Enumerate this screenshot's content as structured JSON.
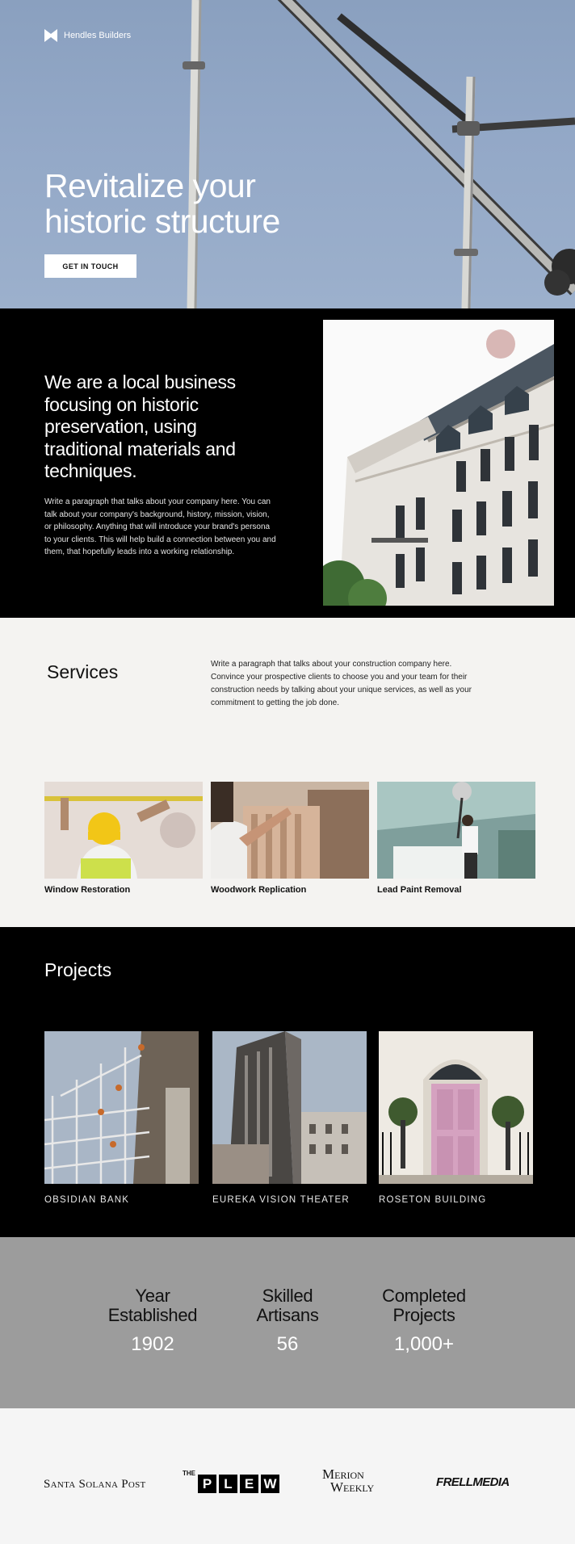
{
  "brand": {
    "name": "Hendles Builders"
  },
  "hero": {
    "title_line1": "Revitalize your",
    "title_line2": "historic structure",
    "cta_label": "GET IN TOUCH"
  },
  "about": {
    "heading": "We are a local business focusing on historic preservation, using traditional materials and techniques.",
    "body": "Write a paragraph that talks about your company here. You can talk about your company's background, history, mission, vision, or philosophy. Anything that will introduce your brand's persona to your clients. This will help build a connection between you and them, that hopefully leads into a working relationship."
  },
  "services": {
    "title": "Services",
    "intro": "Write a paragraph that talks about your construction company here. Convince your prospective clients to choose you and your team for their construction needs by talking about your unique services, as well as your commitment to getting the job done.",
    "items": [
      {
        "label": "Window Restoration"
      },
      {
        "label": "Woodwork Replication"
      },
      {
        "label": "Lead Paint Removal"
      }
    ]
  },
  "projects": {
    "title": "Projects",
    "items": [
      {
        "label": "OBSIDIAN BANK"
      },
      {
        "label": "EUREKA VISION THEATER"
      },
      {
        "label": "ROSETON BUILDING"
      }
    ]
  },
  "stats": [
    {
      "line1": "Year",
      "line2": "Established",
      "value": "1902"
    },
    {
      "line1": "Skilled",
      "line2": "Artisans",
      "value": "56"
    },
    {
      "line1": "Completed",
      "line2": "Projects",
      "value": "1,000+"
    }
  ],
  "press": {
    "logo1": "Santa Solana Post",
    "logo2_prefix": "THE",
    "logo2_letters": [
      "P",
      "L",
      "E",
      "W"
    ],
    "logo3_line1": "Merion",
    "logo3_line2": "Weekly",
    "logo4": "FRELLMEDIA"
  },
  "colors": {
    "hero_sky": "#93a8c7",
    "dark_section": "#000000",
    "light_section": "#f4f3f1",
    "stats_bg": "#9c9c9c",
    "press_bg": "#f5f5f5"
  }
}
